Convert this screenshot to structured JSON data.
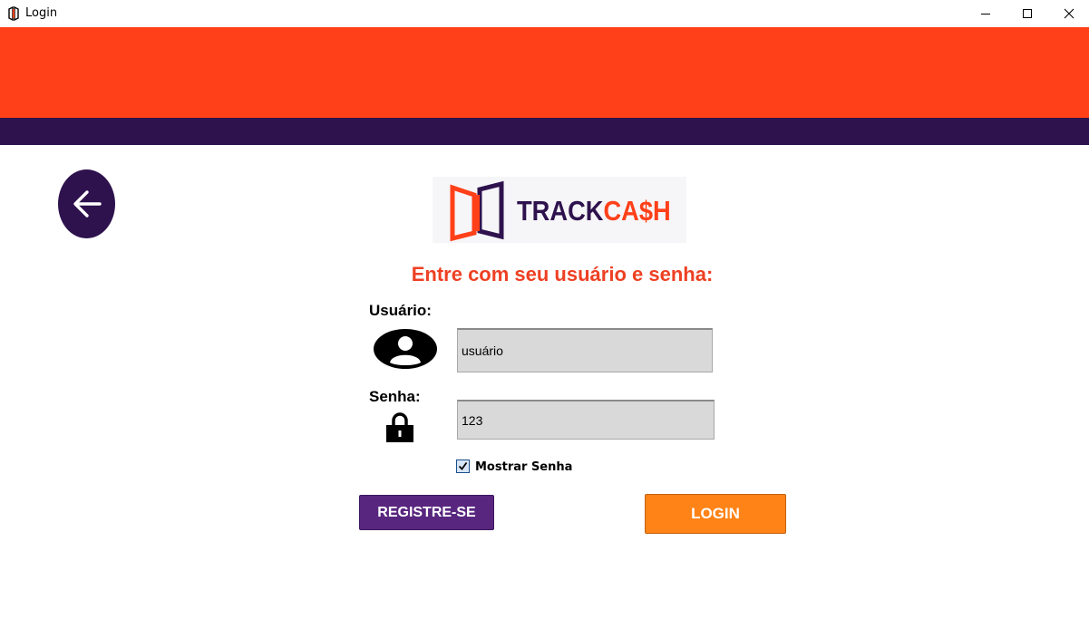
{
  "window": {
    "title": "Login",
    "controls": [
      "minimize-icon",
      "maximize-icon",
      "close-icon"
    ]
  },
  "colors": {
    "header_orange": "#ff4019",
    "header_purple": "#2e124d",
    "heading_red": "#ee4023",
    "register_purple": "#58267f",
    "login_orange": "#ff8317",
    "field_gray": "#d9d9d9"
  },
  "back_button": {
    "icon": "arrow-left-icon"
  },
  "logo": {
    "track": "TRACK",
    "cash": "CA$H"
  },
  "heading": "Entre com seu usuário e senha:",
  "form": {
    "user_label": "Usuário:",
    "user_icon": "user-icon",
    "user_value": "usuário",
    "pass_label": "Senha:",
    "pass_icon": "lock-icon",
    "pass_value": "123",
    "show_password_checked": true,
    "show_password_label": "Mostrar Senha"
  },
  "buttons": {
    "register": "REGISTRE-SE",
    "login": "LOGIN"
  }
}
